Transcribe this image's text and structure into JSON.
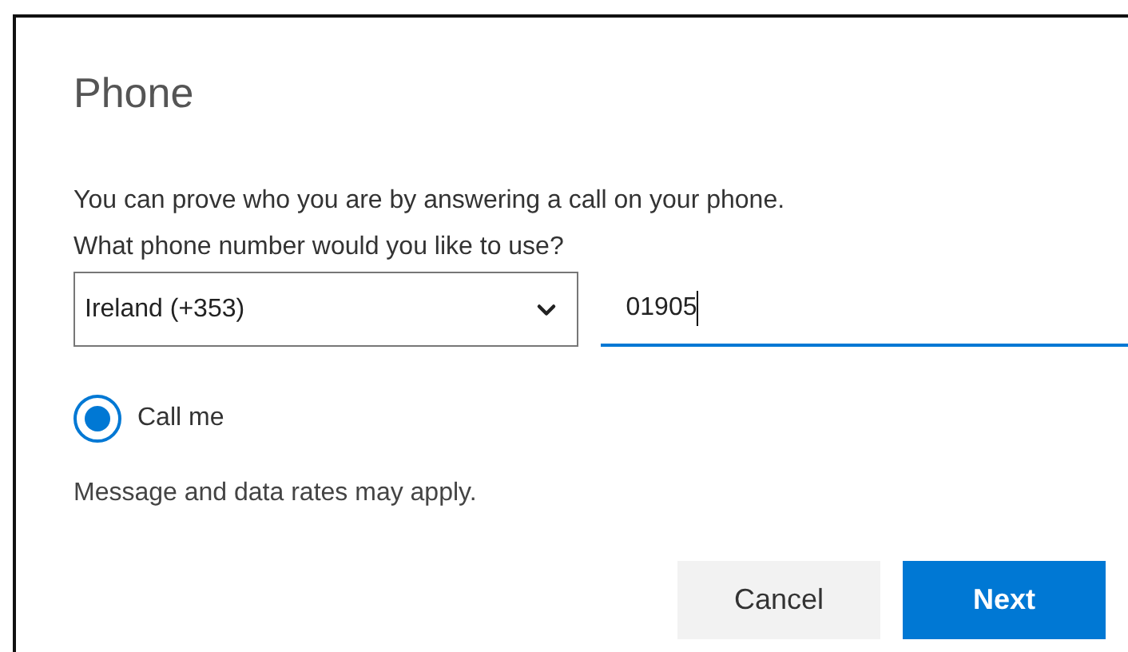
{
  "title": "Phone",
  "description": [
    "You can prove who you are by answering a call on your phone.",
    "What phone number would you like to use?"
  ],
  "country_select": {
    "value": "Ireland (+353)"
  },
  "phone_field": {
    "value": "01905",
    "focused": true
  },
  "options": [
    {
      "label": "Call me",
      "selected": true
    }
  ],
  "note": "Message and data rates may apply.",
  "buttons": [
    {
      "label": "Cancel",
      "kind": "secondary"
    },
    {
      "label": "Next",
      "kind": "primary"
    }
  ]
}
